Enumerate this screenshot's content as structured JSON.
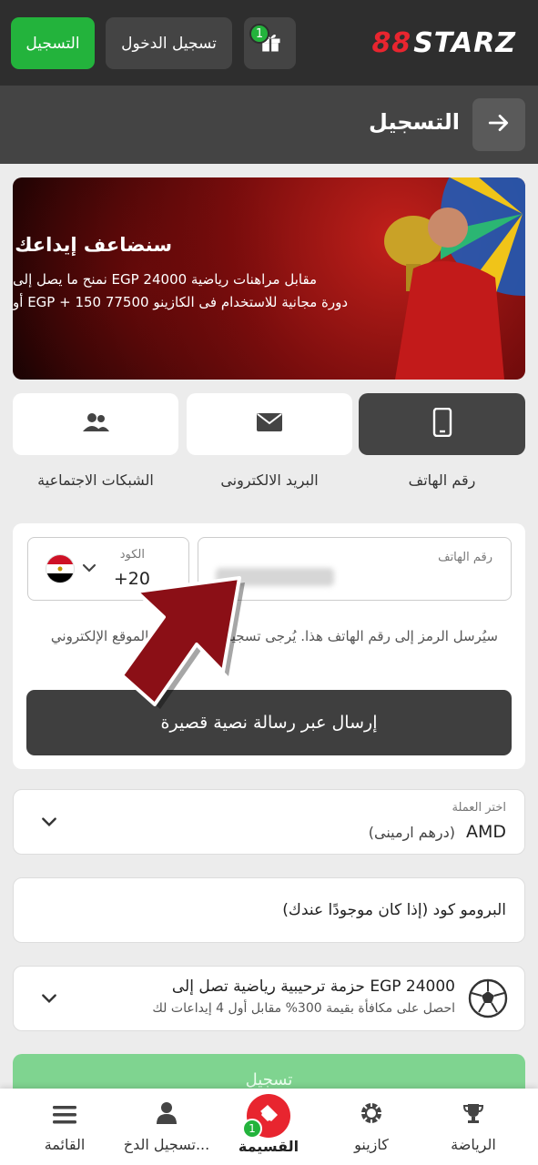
{
  "header": {
    "register_label": "التسجيل",
    "login_label": "تسجيل الدخول",
    "gift_badge": "1",
    "logo_prefix": "88",
    "logo_text": "STARZ",
    "brand_green": "#23b33c",
    "brand_red": "#e8252f"
  },
  "subheader": {
    "title": "التسجيل",
    "back_icon": "arrow-right-icon"
  },
  "banner": {
    "title": "سنضاعف إيداعك",
    "line1": "نمنح ما يصل إلى EGP 24000 مقابل مراهنات رياضية",
    "line2": "أو EGP + 150 77500 دورة مجانية للاستخدام فى الكازينو"
  },
  "methods": {
    "social": "الشبكات الاجتماعية",
    "email": "البريد الالكترونى",
    "phone": "رقم الهاتف"
  },
  "phone_form": {
    "code_label": "الكود",
    "code_value": "+20",
    "phone_label": "رقم الهاتف",
    "hint": "سيُرسل الرمز إلى رقم الهاتف هذا. يُرجى تسجيل الدخول إلى الموقع الإلكتروني",
    "sms_button": "إرسال عبر رسالة نصية قصيرة"
  },
  "currency": {
    "label": "اختر العملة",
    "value": "AMD",
    "description": "(درهم ارمينى)"
  },
  "promo": {
    "placeholder": "البرومو كود (إذا كان موجودًا عندك)"
  },
  "bonus": {
    "title": "حزمة ترحيبية رياضية تصل إلى EGP 24000",
    "subtitle": "احصل على مكافأة بقيمة 300% مقابل أول 4 إيداعات لك"
  },
  "submit_label": "تسجيل",
  "bottom_nav": {
    "sports": "الرياضة",
    "casino": "كازينو",
    "coupon": "القسيمة",
    "coupon_badge": "1",
    "login": "تسجيل الدخ...",
    "menu": "القائمة"
  }
}
